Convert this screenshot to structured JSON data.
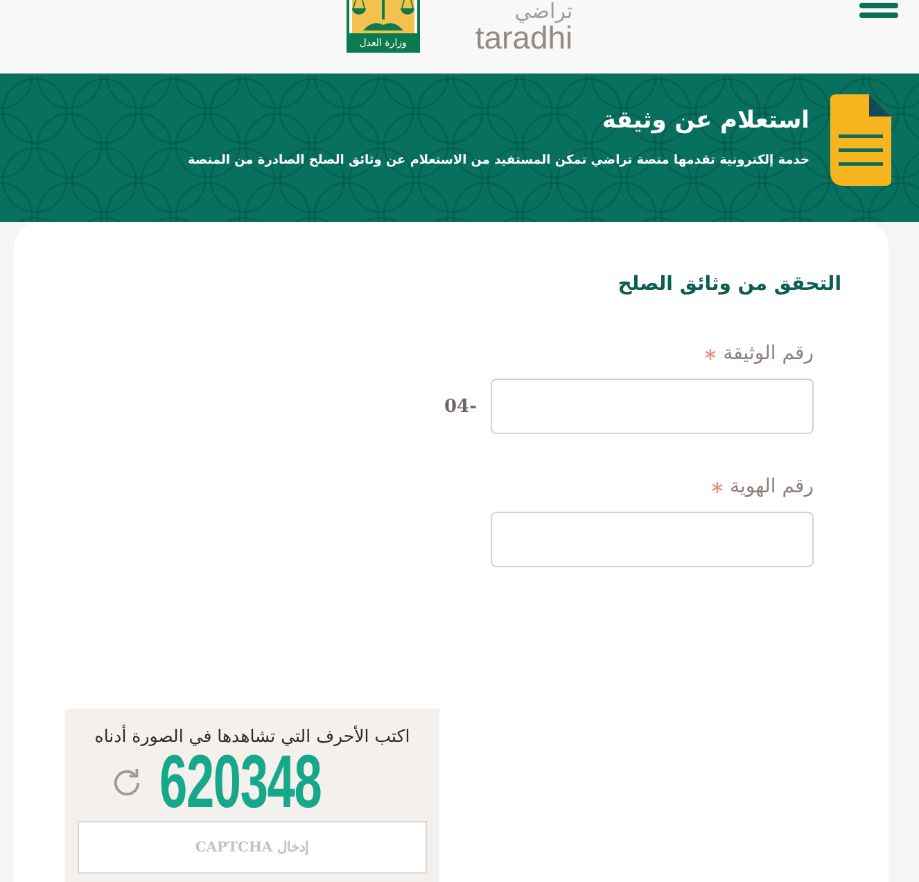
{
  "header": {
    "logo": {
      "emblem_caption": "وزارة العدل",
      "name_arabic": "تراضي",
      "name_latin": "taradhi"
    }
  },
  "banner": {
    "title": "استعلام عن وثيقة",
    "subtitle": "خدمة إلكترونية تقدمها منصة تراضي تمكن المستفيد من الاستعلام عن وثائق الصلح الصادرة من المنصة"
  },
  "form": {
    "title": "التحقق من وثائق الصلح",
    "fields": [
      {
        "label": "رقم الوثيقة",
        "required": true,
        "prefix": "04-"
      },
      {
        "label": "رقم الهوية",
        "required": true
      }
    ]
  },
  "captcha": {
    "instruction": "اكتب الأحرف التي تشاهدها في الصورة أدناه",
    "code": "620348",
    "input": {
      "placeholder": "إدخال CAPTCHA"
    }
  }
}
